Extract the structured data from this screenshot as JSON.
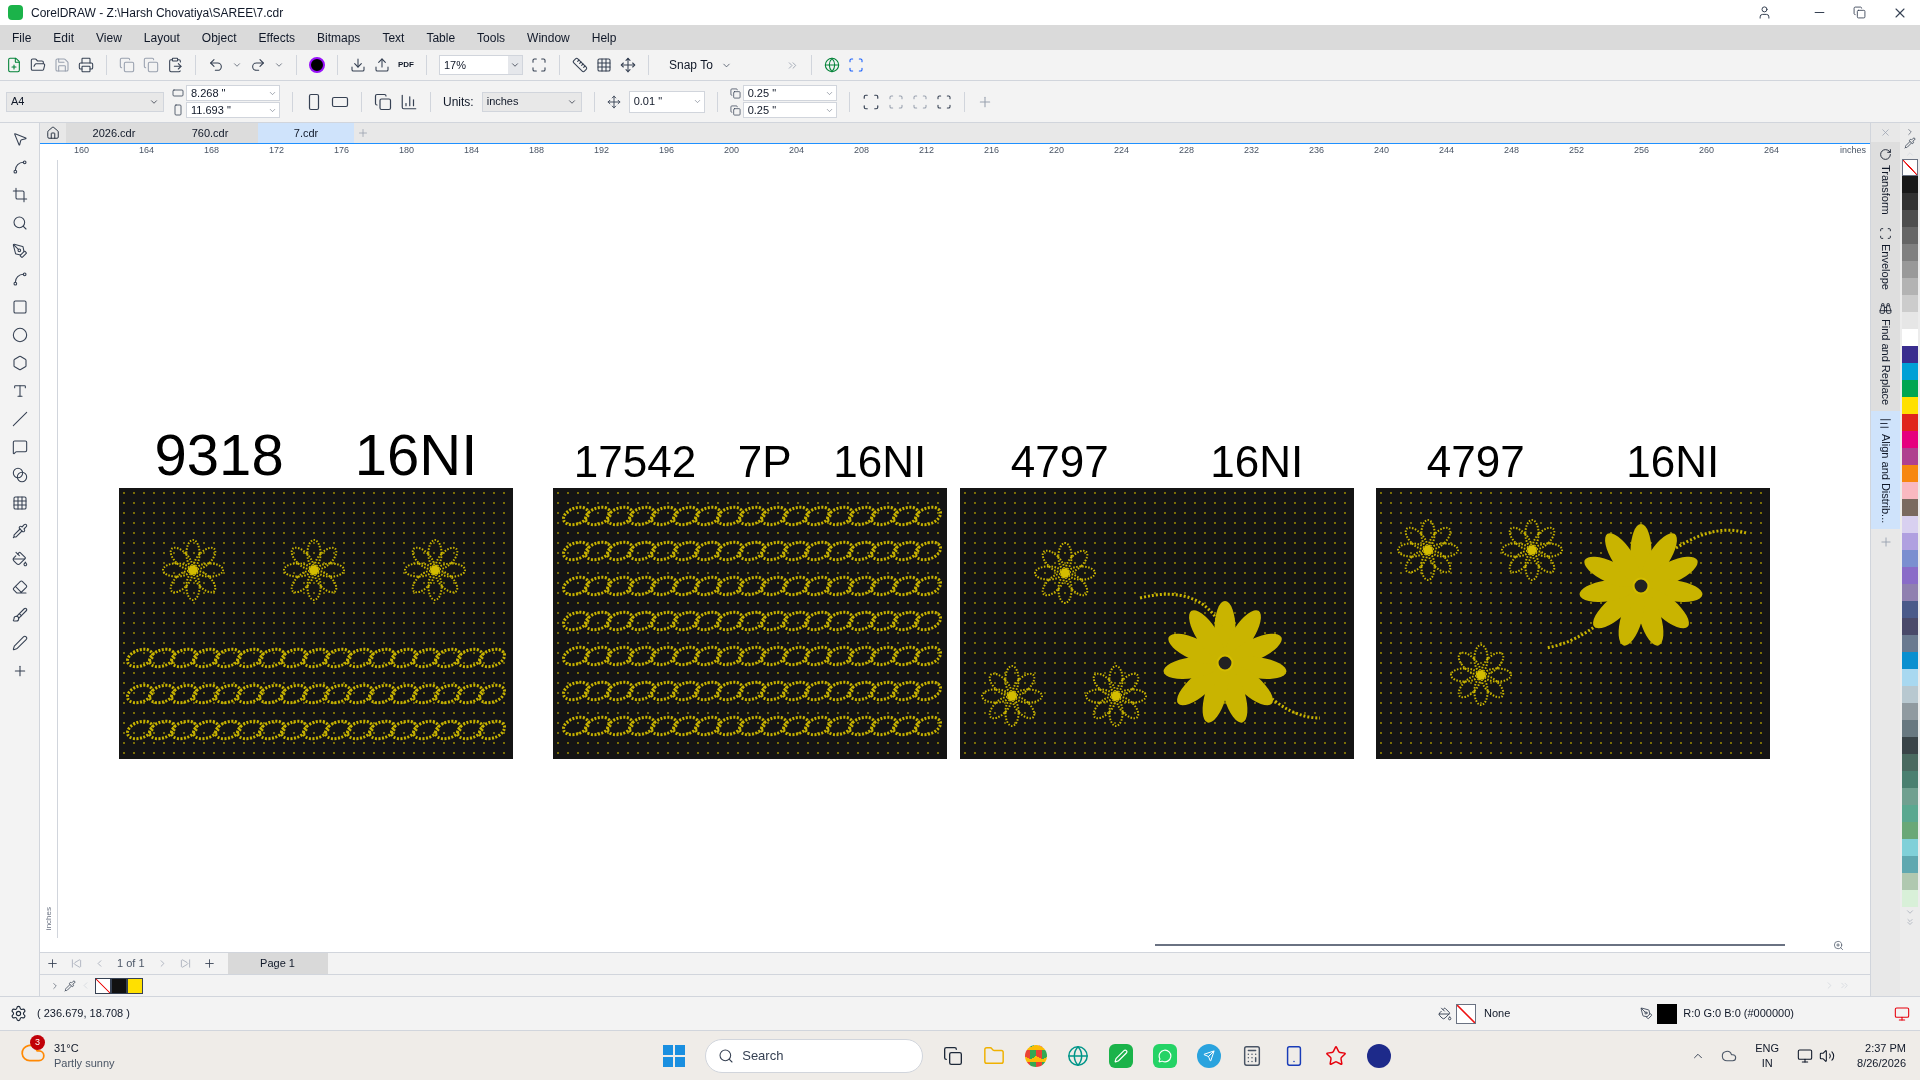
{
  "window": {
    "title": "CorelDRAW - Z:\\Harsh Chovatiya\\SAREE\\7.cdr"
  },
  "menu": [
    "File",
    "Edit",
    "View",
    "Layout",
    "Object",
    "Effects",
    "Bitmaps",
    "Text",
    "Table",
    "Tools",
    "Window",
    "Help"
  ],
  "toolbar": {
    "pdf_label": "PDF",
    "zoom": "17%",
    "snap": "Snap To"
  },
  "property_bar": {
    "page_size": "A4",
    "width": "8.268 \"",
    "height": "11.693 \"",
    "units_label": "Units:",
    "units": "inches",
    "nudge": "0.01 \"",
    "dup_x": "0.25 \"",
    "dup_y": "0.25 \""
  },
  "doc_tabs": [
    {
      "label": "2026.cdr",
      "selected": false
    },
    {
      "label": "760.cdr",
      "selected": false
    },
    {
      "label": "7.cdr",
      "selected": true
    }
  ],
  "ruler": {
    "ticks": [
      "160",
      "164",
      "168",
      "172",
      "176",
      "180",
      "184",
      "188",
      "192",
      "196",
      "200",
      "204",
      "208",
      "212",
      "216",
      "220",
      "224",
      "228",
      "232",
      "236",
      "240",
      "244",
      "248",
      "252",
      "256",
      "260",
      "264"
    ],
    "unit": "inches",
    "vertical_unit": "inches"
  },
  "artboard": [
    {
      "kind": "flowers-chains",
      "labels": [
        "9318",
        "16NI"
      ]
    },
    {
      "kind": "chains",
      "labels": [
        "17542",
        "7P",
        "16NI"
      ]
    },
    {
      "kind": "flower-right",
      "labels": [
        "4797",
        "16NI"
      ]
    },
    {
      "kind": "flower-left",
      "labels": [
        "4797",
        "16NI"
      ]
    }
  ],
  "dockers": [
    {
      "label": "Transform",
      "selected": false
    },
    {
      "label": "Envelope",
      "selected": false
    },
    {
      "label": "Find and Replace",
      "selected": false
    },
    {
      "label": "Align and Distrib...",
      "selected": true
    }
  ],
  "palette": [
    {
      "kind": "none"
    },
    {
      "kind": "color",
      "color": "#1a1a1a"
    },
    {
      "kind": "color",
      "color": "#333333"
    },
    {
      "kind": "color",
      "color": "#4d4d4d"
    },
    {
      "kind": "color",
      "color": "#666666"
    },
    {
      "kind": "color",
      "color": "#808080"
    },
    {
      "kind": "color",
      "color": "#999999"
    },
    {
      "kind": "color",
      "color": "#b3b3b3"
    },
    {
      "kind": "color",
      "color": "#cccccc"
    },
    {
      "kind": "color",
      "color": "#e6e6e6"
    },
    {
      "kind": "color",
      "color": "#ffffff"
    },
    {
      "kind": "color",
      "color": "#3a2d8f"
    },
    {
      "kind": "color",
      "color": "#00a0d6"
    },
    {
      "kind": "color",
      "color": "#00a651"
    },
    {
      "kind": "color",
      "color": "#ffe000"
    },
    {
      "kind": "color",
      "color": "#e0261b"
    },
    {
      "kind": "color",
      "color": "#e6007e"
    },
    {
      "kind": "color",
      "color": "#b0408f"
    },
    {
      "kind": "color",
      "color": "#f7870f"
    },
    {
      "kind": "color",
      "color": "#f9b8c0"
    },
    {
      "kind": "color",
      "color": "#7a6a60"
    },
    {
      "kind": "color",
      "color": "#d8d0f0"
    },
    {
      "kind": "color",
      "color": "#b0a0e0"
    },
    {
      "kind": "color",
      "color": "#7b8fd0"
    },
    {
      "kind": "color",
      "color": "#8a6cc8"
    },
    {
      "kind": "color",
      "color": "#9080b0"
    },
    {
      "kind": "color",
      "color": "#4a5a8a"
    },
    {
      "kind": "color",
      "color": "#4a4a6a"
    },
    {
      "kind": "color",
      "color": "#6a7a90"
    },
    {
      "kind": "color",
      "color": "#0a90d0"
    },
    {
      "kind": "color",
      "color": "#a8d8f0"
    },
    {
      "kind": "color",
      "color": "#b8c8d0"
    },
    {
      "kind": "color",
      "color": "#909aa0"
    },
    {
      "kind": "color",
      "color": "#687880"
    },
    {
      "kind": "color",
      "color": "#3a4448"
    },
    {
      "kind": "color",
      "color": "#4a6a60"
    },
    {
      "kind": "color",
      "color": "#4a8070"
    },
    {
      "kind": "color",
      "color": "#70a090"
    },
    {
      "kind": "color",
      "color": "#5aa890"
    },
    {
      "kind": "color",
      "color": "#6aa878"
    },
    {
      "kind": "color",
      "color": "#80d0d8"
    },
    {
      "kind": "color",
      "color": "#60a8b0"
    },
    {
      "kind": "color",
      "color": "#b0c8b0"
    },
    {
      "kind": "color",
      "color": "#d8f0d8"
    }
  ],
  "page_nav": {
    "count": "1 of 1",
    "pages": [
      {
        "label": "Page 1",
        "selected": true
      }
    ]
  },
  "document_palette": [
    {
      "kind": "none"
    },
    {
      "kind": "color",
      "color": "#111111"
    },
    {
      "kind": "color",
      "color": "#ffe000"
    }
  ],
  "status": {
    "coords": "( 236.679, 18.708 )",
    "fill": "None",
    "outline": "R:0 G:0 B:0 (#000000)"
  },
  "taskbar": {
    "weather_badge": "3",
    "temperature": "31°C",
    "weather": "Partly sunny",
    "search": "Search",
    "language": "ENG",
    "region": "IN",
    "time": "2:37 PM",
    "date": "8/26/2026"
  }
}
